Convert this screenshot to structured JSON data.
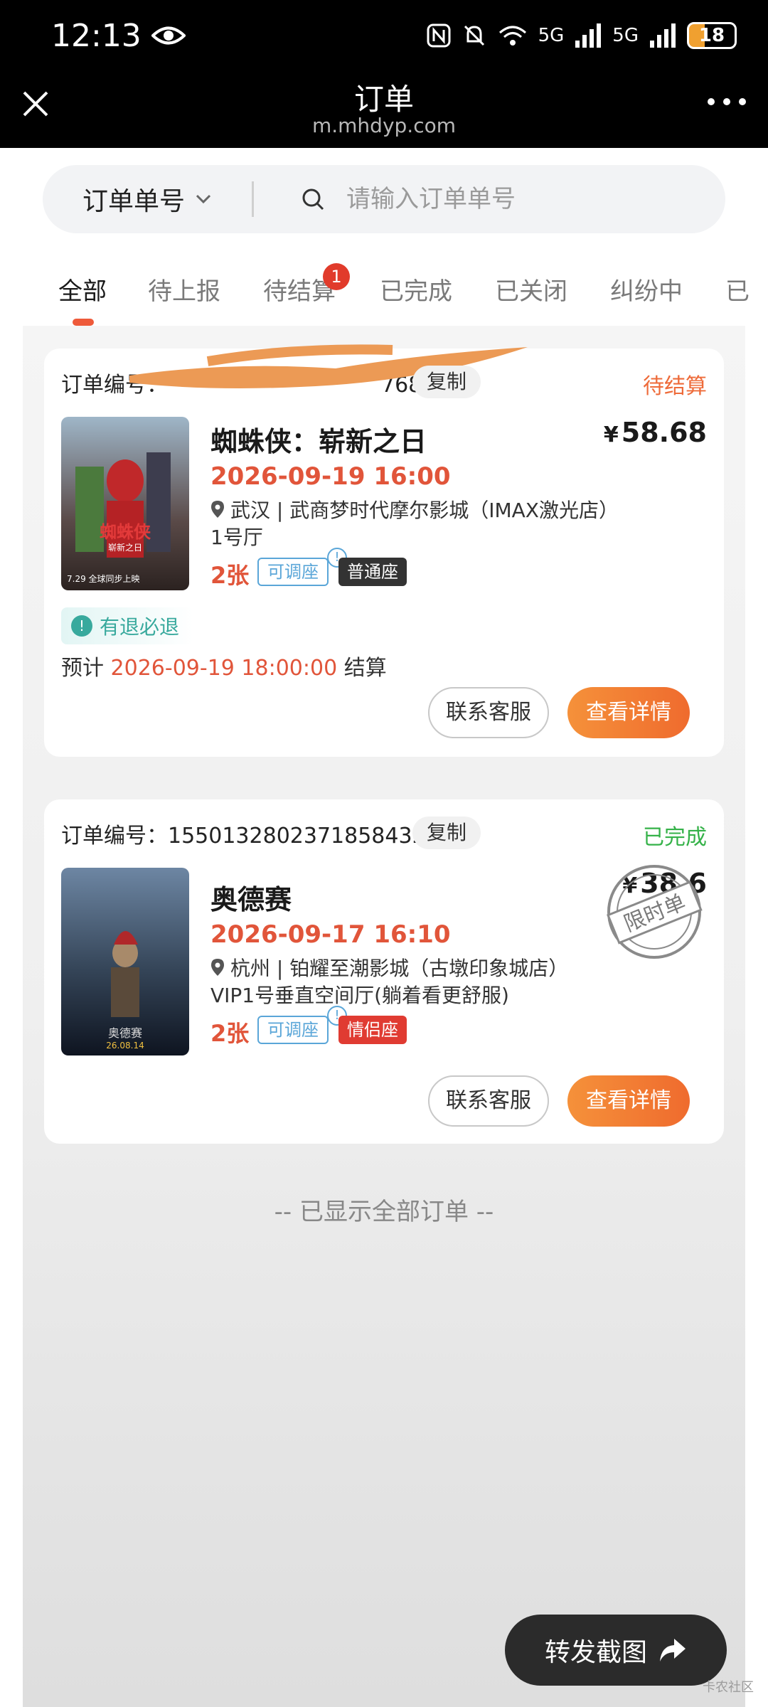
{
  "status_bar": {
    "time": "12:13",
    "battery": "18",
    "network": "5G"
  },
  "header": {
    "title": "订单",
    "url": "m.mhdyp.com"
  },
  "search": {
    "type_label": "订单单号",
    "placeholder": "请输入订单单号"
  },
  "tabs": [
    {
      "label": "全部"
    },
    {
      "label": "待上报"
    },
    {
      "label": "待结算",
      "badge": "1"
    },
    {
      "label": "已完成"
    },
    {
      "label": "已关闭"
    },
    {
      "label": "纠纷中"
    },
    {
      "label": "已"
    }
  ],
  "orders": [
    {
      "order_no": "订单编号：",
      "order_no_tail": "768",
      "copy_label": "复制",
      "status": "待结算",
      "title": "蜘蛛侠：崭新之日",
      "price_symbol": "¥",
      "price": "58.68",
      "showtime": "2026-09-19 16:00",
      "venue": "武汉 | 武商梦时代摩尔影城（IMAX激光店）",
      "hall": "1号厅",
      "tickets": "2张",
      "adjust_tag": "可调座",
      "seat_tag": "普通座",
      "refund_tag": "有退必退",
      "settle_prefix": "预计",
      "settle_date": "2026-09-19 18:00:00",
      "settle_suffix": "结算",
      "btn_service": "联系客服",
      "btn_detail": "查看详情",
      "poster_text": "蜘蛛侠",
      "poster_sub": "崭新之日",
      "poster_date": "7.29 全球同步上映"
    },
    {
      "order_no": "订单编号：1550132802371858432",
      "copy_label": "复制",
      "status": "已完成",
      "title": "奥德赛",
      "price_symbol": "¥",
      "price": "38.6",
      "showtime": "2026-09-17 16:10",
      "venue": "杭州 | 铂耀至潮影城（古墩印象城店）",
      "hall": "VIP1号垂直空间厅(躺着看更舒服)",
      "tickets": "2张",
      "adjust_tag": "可调座",
      "seat_tag": "情侣座",
      "stamp_text": "限时单",
      "btn_service": "联系客服",
      "btn_detail": "查看详情",
      "poster_text": "奥德赛",
      "poster_date": "26.08.14"
    }
  ],
  "end_text": "-- 已显示全部订单 --",
  "share_button": "转发截图",
  "watermark": "卡农社区",
  "colors": {
    "accent": "#ef6b2e",
    "pending": "#ee6b3a",
    "done": "#35b249",
    "price_red": "#e1553a"
  }
}
